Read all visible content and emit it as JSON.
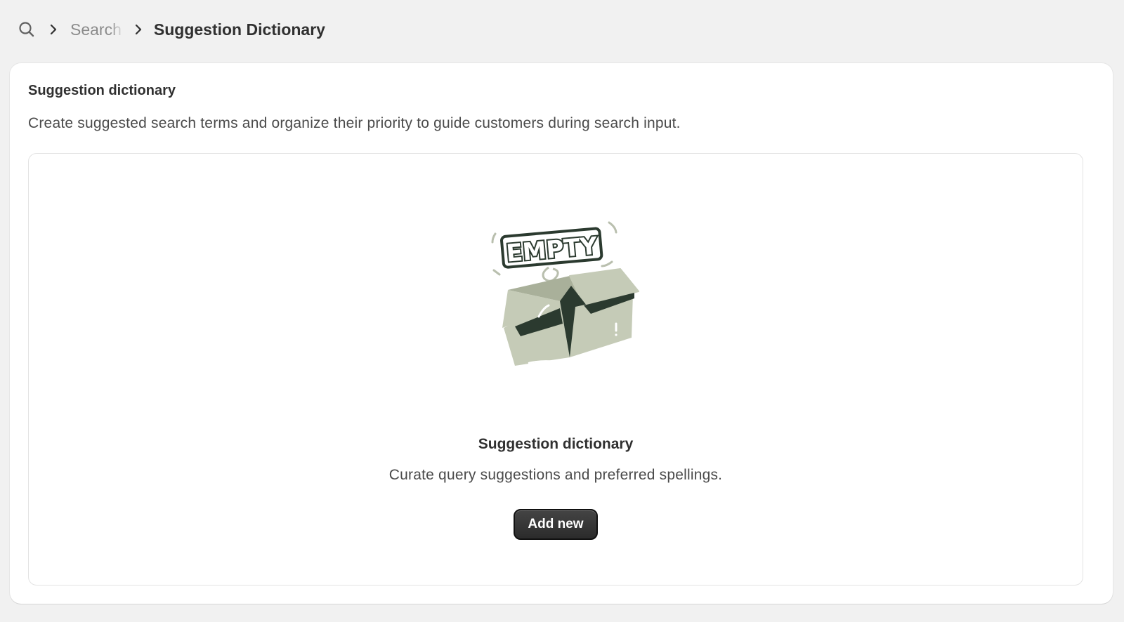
{
  "breadcrumb": {
    "icon": "search-icon",
    "items": [
      {
        "label": "Search",
        "icon": "chevron-right-icon"
      },
      {
        "label": "Suggestion Dictionary",
        "icon": "chevron-right-icon"
      }
    ]
  },
  "card": {
    "title": "Suggestion dictionary",
    "description": "Create suggested search terms and organize their priority to guide customers during search input."
  },
  "empty_state": {
    "illustration": "empty-box-illustration",
    "illustration_text": "EMPTY",
    "title": "Suggestion dictionary",
    "description": "Curate query suggestions and preferred spellings.",
    "button_label": "Add new"
  },
  "colors": {
    "background": "#f1f1f1",
    "card": "#ffffff",
    "button": "#303030",
    "box_light": "#c5cbb7",
    "box_dark": "#2b3a2f"
  }
}
